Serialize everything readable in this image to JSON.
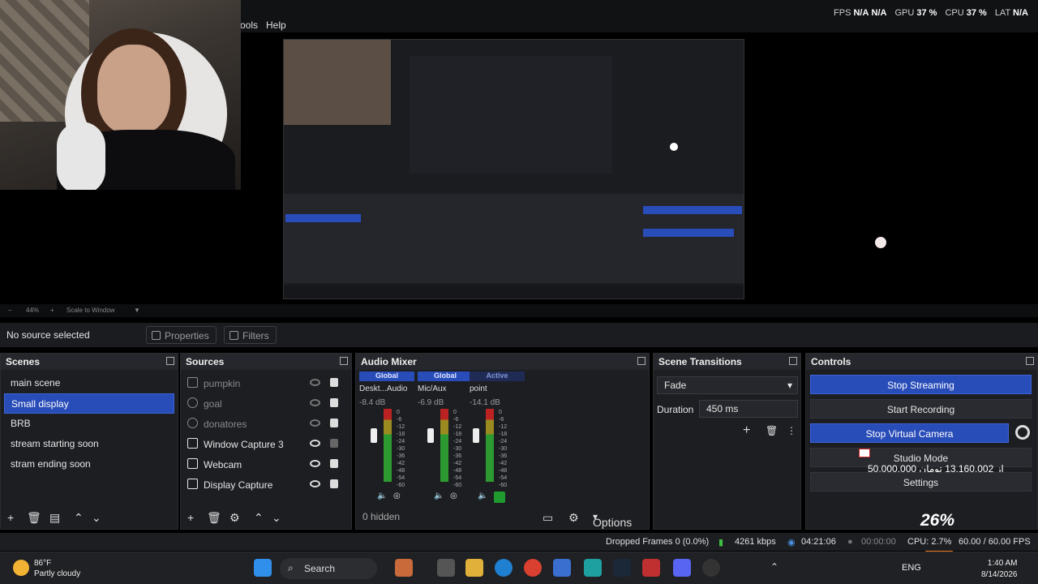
{
  "menu": {
    "tools": "ools",
    "help": "Help"
  },
  "stats": {
    "fps_label": "FPS",
    "fps_value": "N/A",
    "fps_value2": "N/A",
    "gpu_label": "GPU",
    "gpu_value": "37 %",
    "cpu_label": "CPU",
    "cpu_value": "37 %",
    "lat_label": "LAT",
    "lat_value": "N/A"
  },
  "zoom": {
    "level": "44%",
    "mode": "Scale to Window"
  },
  "source_toolbar": {
    "no_source": "No source selected",
    "properties": "Properties",
    "filters": "Filters"
  },
  "scenes": {
    "title": "Scenes",
    "items": [
      "main scene",
      "Small display",
      "BRB",
      "stream starting soon",
      "stram ending soon"
    ],
    "selected": 1
  },
  "sources": {
    "title": "Sources",
    "items": [
      {
        "name": "pumpkin",
        "visible": false,
        "locked": true
      },
      {
        "name": "goal",
        "visible": false,
        "locked": true
      },
      {
        "name": "donatores",
        "visible": false,
        "locked": true
      },
      {
        "name": "Window Capture 3",
        "visible": true,
        "locked": false
      },
      {
        "name": "Webcam",
        "visible": true,
        "locked": true
      },
      {
        "name": "Display Capture",
        "visible": true,
        "locked": true
      }
    ]
  },
  "mixer": {
    "title": "Audio Mixer",
    "channels": [
      {
        "badge": "Global",
        "name": "Deskt...Audio",
        "db": "-8.4 dB"
      },
      {
        "badge": "Global",
        "name": "Mic/Aux",
        "db": "-6.9 dB"
      },
      {
        "badge": "Active",
        "name": "point",
        "db": "-14.1 dB"
      }
    ],
    "scale": [
      "0",
      "-6",
      "-12",
      "-18",
      "-24",
      "-30",
      "-36",
      "-42",
      "-48",
      "-54",
      "-60"
    ],
    "hidden": "0 hidden",
    "options": "Options"
  },
  "transitions": {
    "title": "Scene Transitions",
    "selected": "Fade",
    "duration_label": "Duration",
    "duration_value": "450 ms"
  },
  "controls": {
    "title": "Controls",
    "stop_streaming": "Stop Streaming",
    "start_recording": "Start Recording",
    "stop_virtual_camera": "Stop Virtual Camera",
    "studio_mode": "Studio Mode",
    "settings": "Settings",
    "overlay_text": "50,000,000 از 13,160,002 تومان",
    "overlay_pct": "26%"
  },
  "status": {
    "dropped": "Dropped Frames 0 (0.0%)",
    "kbps": "4261 kbps",
    "stream_time": "04:21:06",
    "rec_time": "00:00:00",
    "cpu": "CPU: 2.7%",
    "fps": "60.00 / 60.00 FPS"
  },
  "taskbar": {
    "temp": "86°F",
    "weather": "Partly cloudy",
    "search": "Search",
    "lang": "ENG",
    "time": "1:40 AM",
    "date": "8/14/2026"
  },
  "colors": {
    "accent": "#284cb8",
    "panel": "#1d1e22",
    "header": "#26272c"
  }
}
